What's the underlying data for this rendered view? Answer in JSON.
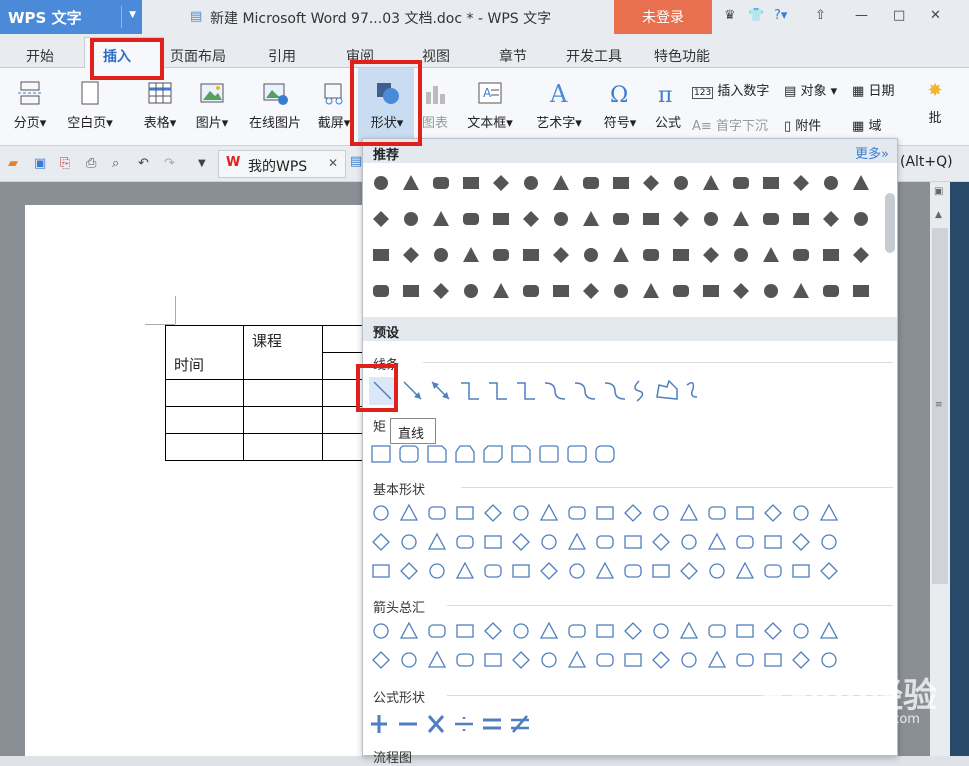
{
  "app": {
    "name": "WPS 文字",
    "title": "新建 Microsoft Word 97...03 文档.doc * - WPS 文字",
    "login": "未登录"
  },
  "menu": [
    "开始",
    "插入",
    "页面布局",
    "引用",
    "审阅",
    "视图",
    "章节",
    "开发工具",
    "特色功能"
  ],
  "ribbon": {
    "page_break": "分页",
    "blank_page": "空白页",
    "table": "表格",
    "picture": "图片",
    "online_picture": "在线图片",
    "screenshot": "截屏",
    "shape": "形状",
    "chart": "图表",
    "textbox": "文本框",
    "wordart": "艺术字",
    "symbol": "符号",
    "formula": "公式",
    "insert_number": "插入数字",
    "object": "对象",
    "date": "日期",
    "drop_cap": "首字下沉",
    "attachment": "附件",
    "field": "域",
    "comment": "批"
  },
  "quickaccess": {
    "my_wps": "我的WPS",
    "hint": "(Alt+Q)"
  },
  "document": {
    "cell_course": "课程",
    "cell_time": "时间"
  },
  "shapes_panel": {
    "recommended": "推荐",
    "more": "更多»",
    "presets": "预设",
    "lines": "线条",
    "rectangles": "矩",
    "basic": "基本形状",
    "arrows": "箭头总汇",
    "equation": "公式形状",
    "flowchart": "流程图",
    "tooltip": "直线"
  },
  "watermark": {
    "brand": "Baidu经验",
    "url": "jingyan.baidu.com"
  },
  "colors": {
    "accent": "#4b8ad8",
    "login": "#e8704f",
    "highlight": "#e0201a",
    "shape_blue": "#4f7fbf"
  }
}
